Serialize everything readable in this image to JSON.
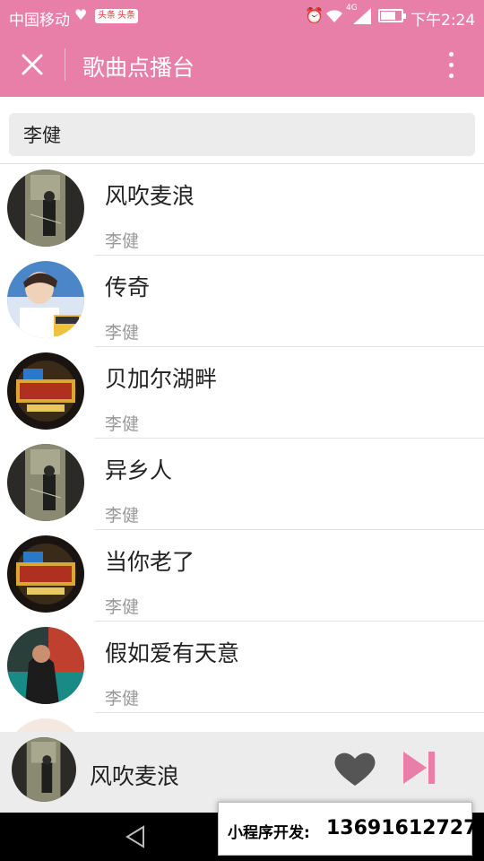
{
  "status_bar": {
    "carrier": "中国移动",
    "badges": [
      "头条",
      "头条"
    ],
    "network_label": "4G",
    "time": "下午2:24"
  },
  "header": {
    "title": "歌曲点播台",
    "close_icon": "close-icon",
    "more_icon": "more-vertical-icon"
  },
  "search": {
    "value": "李健"
  },
  "songs": [
    {
      "title": "风吹麦浪",
      "artist": "李健",
      "cover": "album-dark"
    },
    {
      "title": "传奇",
      "artist": "李健",
      "cover": "portrait-blue"
    },
    {
      "title": "贝加尔湖畔",
      "artist": "李健",
      "cover": "singer-show"
    },
    {
      "title": "异乡人",
      "artist": "李健",
      "cover": "album-dark"
    },
    {
      "title": "当你老了",
      "artist": "李健",
      "cover": "singer-show"
    },
    {
      "title": "假如爱有天意",
      "artist": "李健",
      "cover": "album-teal"
    }
  ],
  "player": {
    "now_playing": "风吹麦浪",
    "like_icon": "heart-icon",
    "next_icon": "skip-next-icon",
    "like_color": "#555555",
    "next_color": "#e87fa9"
  },
  "ad_overlay": {
    "label": "小程序开发:",
    "phone": "13691612727"
  },
  "colors": {
    "accent": "#e87fa9",
    "separator": "#e3e3e3",
    "artist_text": "#999999"
  }
}
